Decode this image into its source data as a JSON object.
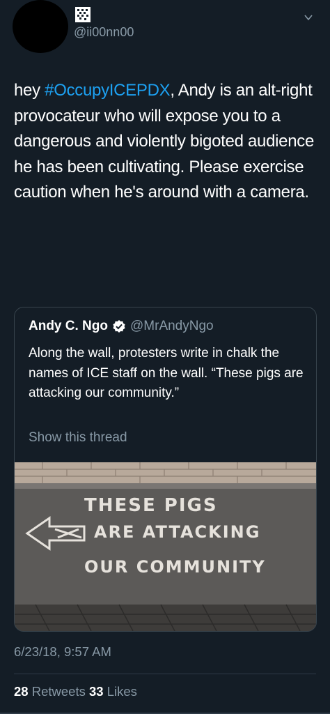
{
  "author": {
    "handle": "@ii00nn00"
  },
  "tweet": {
    "text_before_hashtag": "hey ",
    "hashtag": "#OccupyICEPDX",
    "text_after_hashtag": ", Andy is an alt-right provocateur who will expose you to a dangerous and violently bigoted audience he has been cultivating. Please exercise caution when he's around with a camera."
  },
  "quoted_tweet": {
    "name": "Andy C. Ngo",
    "handle": "@MrAndyNgo",
    "text": "Along the wall, protesters write in chalk the names of ICE staff on the wall. “These pigs are attacking our community.”",
    "show_thread": "Show this thread",
    "photo_chalk_lines": [
      "THESE PIGS",
      "ARE ATTACKING",
      "OUR COMMUNITY"
    ]
  },
  "meta": {
    "timestamp": "6/23/18, 9:57 AM",
    "retweets_count": "28",
    "retweets_label": "Retweets",
    "likes_count": "33",
    "likes_label": "Likes"
  },
  "icons": {
    "grid": "qr-grid-icon",
    "chevron": "chevron-down-icon",
    "verified": "verified-badge-icon"
  },
  "colors": {
    "background": "#141d26",
    "accent": "#1da1f2",
    "secondary_text": "#8899a6",
    "border": "#38444d"
  }
}
